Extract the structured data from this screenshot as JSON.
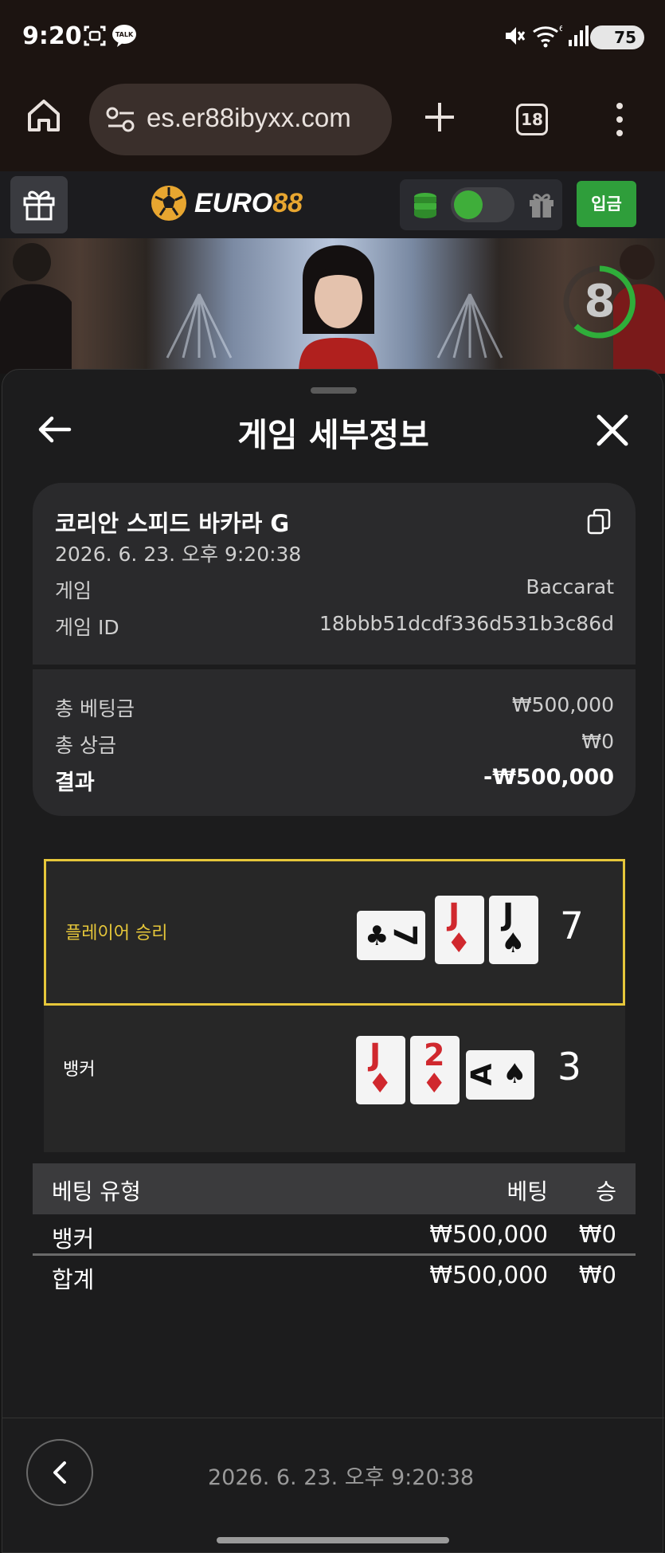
{
  "status_bar": {
    "time": "9:20",
    "battery": "75",
    "icons": [
      "screenshot-icon",
      "talk-icon",
      "mute-icon",
      "wifi-icon",
      "signal-icon",
      "battery-icon"
    ],
    "talk_badge": "TALK"
  },
  "browser": {
    "url": "es.er88ibyxx.com",
    "tab_count": "18"
  },
  "app_header": {
    "logo_text_1": "EURO",
    "logo_text_2": "88",
    "deposit_label": "입금",
    "toggle_on": true
  },
  "video": {
    "countdown": "8"
  },
  "sheet": {
    "title": "게임 세부정보"
  },
  "game_info": {
    "name": "코리안 스피드 바카라 G",
    "datetime": "2026. 6. 23. 오후 9:20:38",
    "game_label": "게임",
    "game_value": "Baccarat",
    "game_id_label": "게임 ID",
    "game_id_value": "18bbb51dcdf336d531b3c86d",
    "total_bet_label": "총 베팅금",
    "total_bet_value": "₩500,000",
    "total_win_label": "총 상금",
    "total_win_value": "₩0",
    "result_label": "결과",
    "result_value": "-₩500,000"
  },
  "hands": {
    "player": {
      "label": "플레이어 승리",
      "score": "7",
      "cards": [
        {
          "rank": "7",
          "suit": "♣",
          "color": "#111111"
        },
        {
          "rank": "J",
          "suit": "♦",
          "color": "#d0282e"
        },
        {
          "rank": "J",
          "suit": "♠",
          "color": "#111111"
        }
      ]
    },
    "banker": {
      "label": "뱅커",
      "score": "3",
      "cards": [
        {
          "rank": "J",
          "suit": "♦",
          "color": "#d0282e"
        },
        {
          "rank": "2",
          "suit": "♦",
          "color": "#d0282e"
        },
        {
          "rank": "A",
          "suit": "♠",
          "color": "#111111"
        }
      ]
    }
  },
  "bets_table": {
    "headers": [
      "베팅 유형",
      "베팅",
      "승"
    ],
    "rows": [
      {
        "type": "뱅커",
        "bet": "₩500,000",
        "win": "₩0"
      }
    ],
    "total": {
      "type": "합계",
      "bet": "₩500,000",
      "win": "₩0"
    }
  },
  "footer": {
    "datetime": "2026. 6. 23. 오후 9:20:38"
  },
  "colors": {
    "accent_green": "#2f9e3b",
    "winner_border": "#e6c73a",
    "logo_gold": "#e8a630",
    "red_suit": "#d0282e"
  }
}
